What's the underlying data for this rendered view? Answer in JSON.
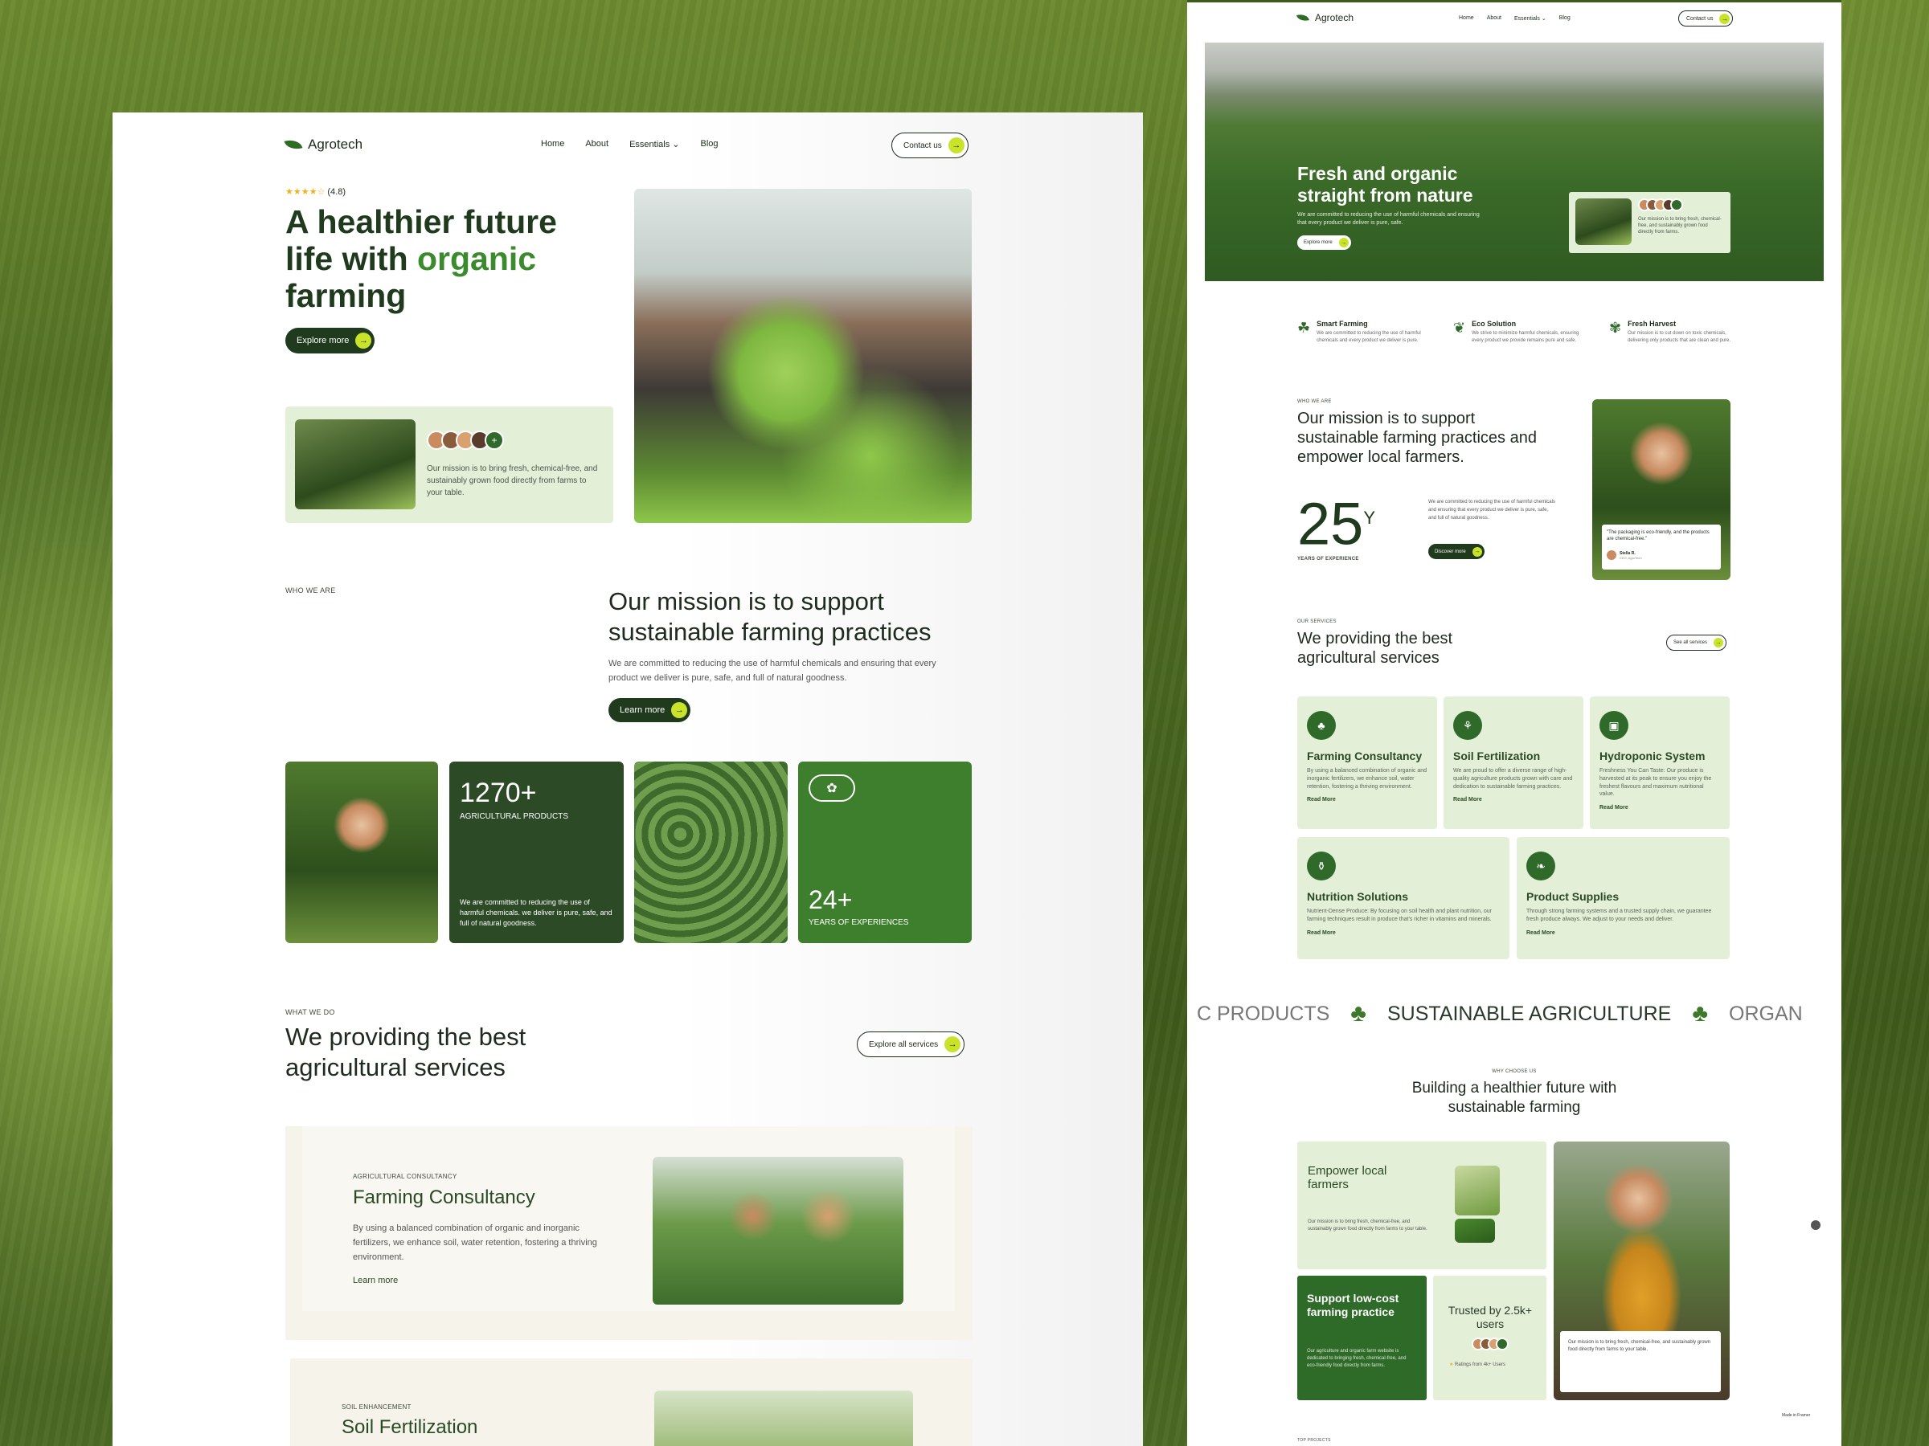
{
  "left": {
    "brand": "Agrotech",
    "nav": [
      "Home",
      "About",
      "Essentials ⌄",
      "Blog"
    ],
    "contact": "Contact us",
    "rating": "(4.8)",
    "hero_title_1": "A healthier future",
    "hero_title_2": "life with ",
    "hero_title_accent": "organic",
    "hero_title_3": "farming",
    "explore": "Explore more",
    "mission_card_text": "Our mission is to bring fresh, chemical-free, and sustainably grown food directly from farms to your table.",
    "who_label": "WHO WE ARE",
    "mission_title": "Our mission is to support sustainable farming practices",
    "mission_desc": "We are committed to reducing the use of harmful chemicals and ensuring that every product we deliver is pure, safe, and full of natural goodness.",
    "learn_more": "Learn more",
    "stat1_num": "1270+",
    "stat1_label": "AGRICULTURAL PRODUCTS",
    "stat1_desc": "We are committed to reducing the use of harmful chemicals. we deliver is pure, safe, and full of natural goodness.",
    "stat2_num": "24+",
    "stat2_label": "YEARS OF EXPERIENCES",
    "what_label": "WHAT WE DO",
    "services_title": "We providing the best agricultural services",
    "explore_services": "Explore all services",
    "svc1_tag": "AGRICULTURAL CONSULTANCY",
    "svc1_title": "Farming Consultancy",
    "svc1_desc": "By using a balanced combination of organic and inorganic fertilizers, we enhance soil, water retention, fostering a thriving environment.",
    "svc1_link": "Learn more",
    "svc2_tag": "SOIL ENHANCEMENT",
    "svc2_title": "Soil Fertilization"
  },
  "right": {
    "brand": "Agrotech",
    "nav": [
      "Home",
      "About",
      "Essentials ⌄",
      "Blog"
    ],
    "contact": "Contact us",
    "hero_title": "Fresh and organic straight from nature",
    "hero_desc": "We are committed to reducing the use of harmful chemicals and ensuring that every product we deliver is pure, safe.",
    "explore": "Explore more",
    "hero_card_text": "Our mission is to bring fresh, chemical-free, and sustainably grown food directly from farms.",
    "features": [
      {
        "title": "Smart Farming",
        "desc": "We are committed to reducing the use of harmful chemicals and every product we deliver is pure."
      },
      {
        "title": "Eco Solution",
        "desc": "We strive to minimize harmful chemicals, ensuring every product we provide remains pure and safe."
      },
      {
        "title": "Fresh Harvest",
        "desc": "Our mission is to cut down on toxic chemicals, delivering only products that are clean and pure."
      }
    ],
    "who_label": "WHO WE ARE",
    "mission_title": "Our mission is to support sustainable farming practices and empower local farmers.",
    "years_num": "25",
    "years_sup": "Y",
    "years_label": "YEARS OF EXPERIENCE",
    "years_desc": "We are committed to reducing the use of harmful chemicals and ensuring that every product we deliver is pure, safe, and full of natural goodness.",
    "discover": "Discover more",
    "quote": "\"The packaging is eco-friendly, and the products are chemical-free.\"",
    "quote_name": "Stella R.",
    "quote_role": "CEO, AgroTech",
    "our_services_label": "OUR SERVICES",
    "services_title": "We providing the best agricultural services",
    "see_all": "See all services",
    "services": [
      {
        "title": "Farming Consultancy",
        "desc": "By using a balanced combination of organic and inorganic fertilizers, we enhance soil, water retention, fostering a thriving environment.",
        "link": "Read More"
      },
      {
        "title": "Soil Fertilization",
        "desc": "We are proud to offer a diverse range of high-quality agriculture products grown with care and dedication to sustainable farming practices.",
        "link": "Read More"
      },
      {
        "title": "Hydroponic System",
        "desc": "Freshness You Can Taste: Our produce is harvested at its peak to ensure you enjoy the freshest flavours and maximum nutritional value.",
        "link": "Read More"
      },
      {
        "title": "Nutrition Solutions",
        "desc": "Nutrient-Dense Produce: By focusing on soil health and plant nutrition, our farming techniques result in produce that's richer in vitamins and minerals.",
        "link": "Read More"
      },
      {
        "title": "Product Supplies",
        "desc": "Through strong farming systems and a trusted supply chain, we guarantee fresh produce always. We adjust to your needs and deliver.",
        "link": "Read More"
      }
    ],
    "marquee": [
      "C PRODUCTS",
      "SUSTAINABLE AGRICULTURE",
      "ORGAN"
    ],
    "why_label": "WHY CHOOSE US",
    "why_title": "Building a healthier future with sustainable farming",
    "empower_title": "Empower local farmers",
    "empower_desc": "Our mission is to bring fresh, chemical-free, and sustainably grown food directly from farms to your table.",
    "support_title": "Support low-cost farming practice",
    "support_desc": "Our agriculture and organic farm website is dedicated to bringing fresh, chemical-free, and eco-friendly food directly from farms.",
    "trusted_title": "Trusted by 2.5k+ users",
    "ratings_text": "Ratings from 4k+ Users",
    "farmer_card_text": "Our mission is to bring fresh, chemical-free, and sustainably grown food directly from farms to your table.",
    "top_projects": "TOP PROJECTS",
    "made_in": "Made in Framer"
  }
}
